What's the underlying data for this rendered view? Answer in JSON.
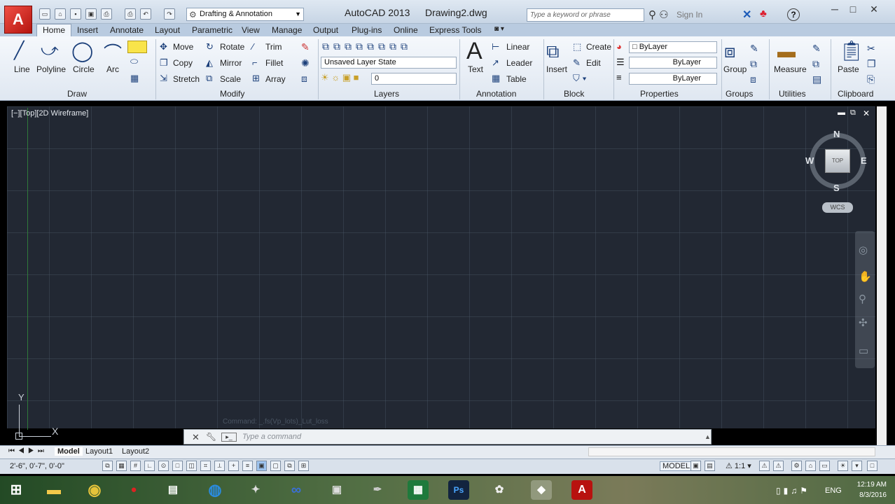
{
  "title": {
    "app": "AutoCAD 2013",
    "file": "Drawing2.dwg",
    "logo_text": "A",
    "workspace": "Drafting & Annotation",
    "search_placeholder": "Type a keyword or phrase",
    "signin": "Sign In"
  },
  "tabs": [
    "Home",
    "Insert",
    "Annotate",
    "Layout",
    "Parametric",
    "View",
    "Manage",
    "Output",
    "Plug-ins",
    "Online",
    "Express Tools"
  ],
  "ribbon": {
    "draw": {
      "panel": "Draw",
      "line": "Line",
      "polyline": "Polyline",
      "circle": "Circle",
      "arc": "Arc"
    },
    "modify": {
      "panel": "Modify",
      "move": "Move",
      "rotate": "Rotate",
      "trim": "Trim",
      "copy": "Copy",
      "mirror": "Mirror",
      "fillet": "Fillet",
      "stretch": "Stretch",
      "scale": "Scale",
      "array": "Array"
    },
    "layers": {
      "panel": "Layers",
      "state": "Unsaved Layer State",
      "current": "0"
    },
    "annotation": {
      "panel": "Annotation",
      "text": "Text",
      "linear": "Linear",
      "leader": "Leader",
      "table": "Table"
    },
    "block": {
      "panel": "Block",
      "insert": "Insert",
      "create": "Create",
      "edit": "Edit"
    },
    "properties": {
      "panel": "Properties",
      "color": "ByLayer",
      "linetype": "ByLayer",
      "lineweight": "ByLayer"
    },
    "groups": {
      "panel": "Groups",
      "group": "Group"
    },
    "utilities": {
      "panel": "Utilities",
      "measure": "Measure"
    },
    "clipboard": {
      "panel": "Clipboard",
      "paste": "Paste"
    }
  },
  "viewport": {
    "controls": "[−][Top][2D Wireframe]",
    "cube_face": "TOP",
    "north": "N",
    "south": "S",
    "east": "E",
    "west": "W",
    "wcs": "WCS",
    "ucs_x": "X",
    "ucs_y": "Y"
  },
  "command": {
    "history": "Command: _.fs(Vp_lots)_Lut_loss",
    "placeholder": "Type a command"
  },
  "layouts": [
    "Model",
    "Layout1",
    "Layout2"
  ],
  "status": {
    "coords": "2'-6\", 0'-7\", 0'-0\"",
    "model": "MODEL",
    "scale": "1:1"
  },
  "taskbar": {
    "lang": "ENG",
    "time": "12:19 AM",
    "date": "8/3/2016"
  }
}
